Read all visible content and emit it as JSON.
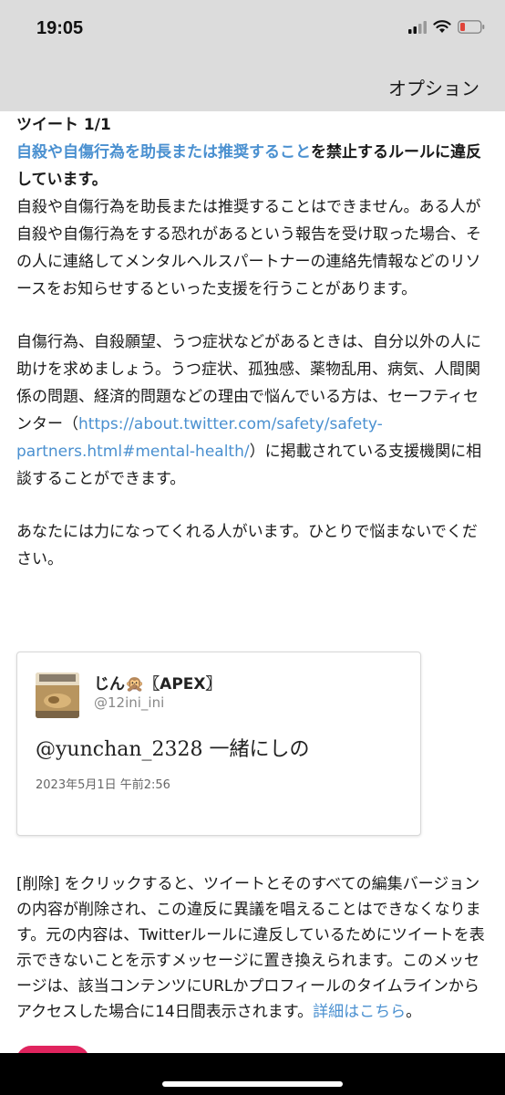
{
  "status_bar": {
    "time": "19:05",
    "icons": [
      "cellular-signal-icon",
      "wifi-icon",
      "battery-low-icon"
    ],
    "battery_color": "#e0443a"
  },
  "header": {
    "options_label": "オプション"
  },
  "notice": {
    "heading": "ツイート 1/1",
    "rule_link": "自殺や自傷行為を助長または推奨すること",
    "rule_suffix": "を禁止するルールに違反しています。",
    "paragraph1": "自殺や自傷行為を助長または推奨することはできません。ある人が自殺や自傷行為をする恐れがあるという報告を受け取った場合、その人に連絡してメンタルヘルスパートナーの連絡先情報などのリソースをお知らせするといった支援を行うことがあります。",
    "paragraph2_before": "自傷行為、自殺願望、うつ症状などがあるときは、自分以外の人に助けを求めましょう。うつ症状、孤独感、薬物乱用、病気、人間関係の問題、経済的問題などの理由で悩んでいる方は、セーフティセンター（",
    "paragraph2_link": "https://about.twitter.com/safety/safety-partners.html#mental-health/",
    "paragraph2_after": "）に掲載されている支援機関に相談することができます。",
    "paragraph3": "あなたには力になってくれる人がいます。ひとりで悩まないでください。"
  },
  "tweet_card": {
    "display_name": "じん🙊〖APEX〗",
    "handle": "@12ini_ini",
    "text": "@yunchan_2328 一緒にしの",
    "date": "2023年5月1日 午前2:56"
  },
  "footer": {
    "text": "[削除] をクリックすると、ツイートとそのすべての編集バージョンの内容が削除され、この違反に異議を唱えることはできなくなります。元の内容は、Twitterルールに違反しているためにツイートを表示できないことを示すメッセージに置き換えられます。このメッセージは、該当コンテンツにURLかプロフィールのタイムラインからアクセスした場合に14日間表示されます。",
    "learn_more_link": "詳細はこちら",
    "learn_more_suffix": "。"
  },
  "colors": {
    "link": "#4a90d0",
    "header_bg": "#dcdcdc",
    "delete_button": "#e0245e"
  }
}
